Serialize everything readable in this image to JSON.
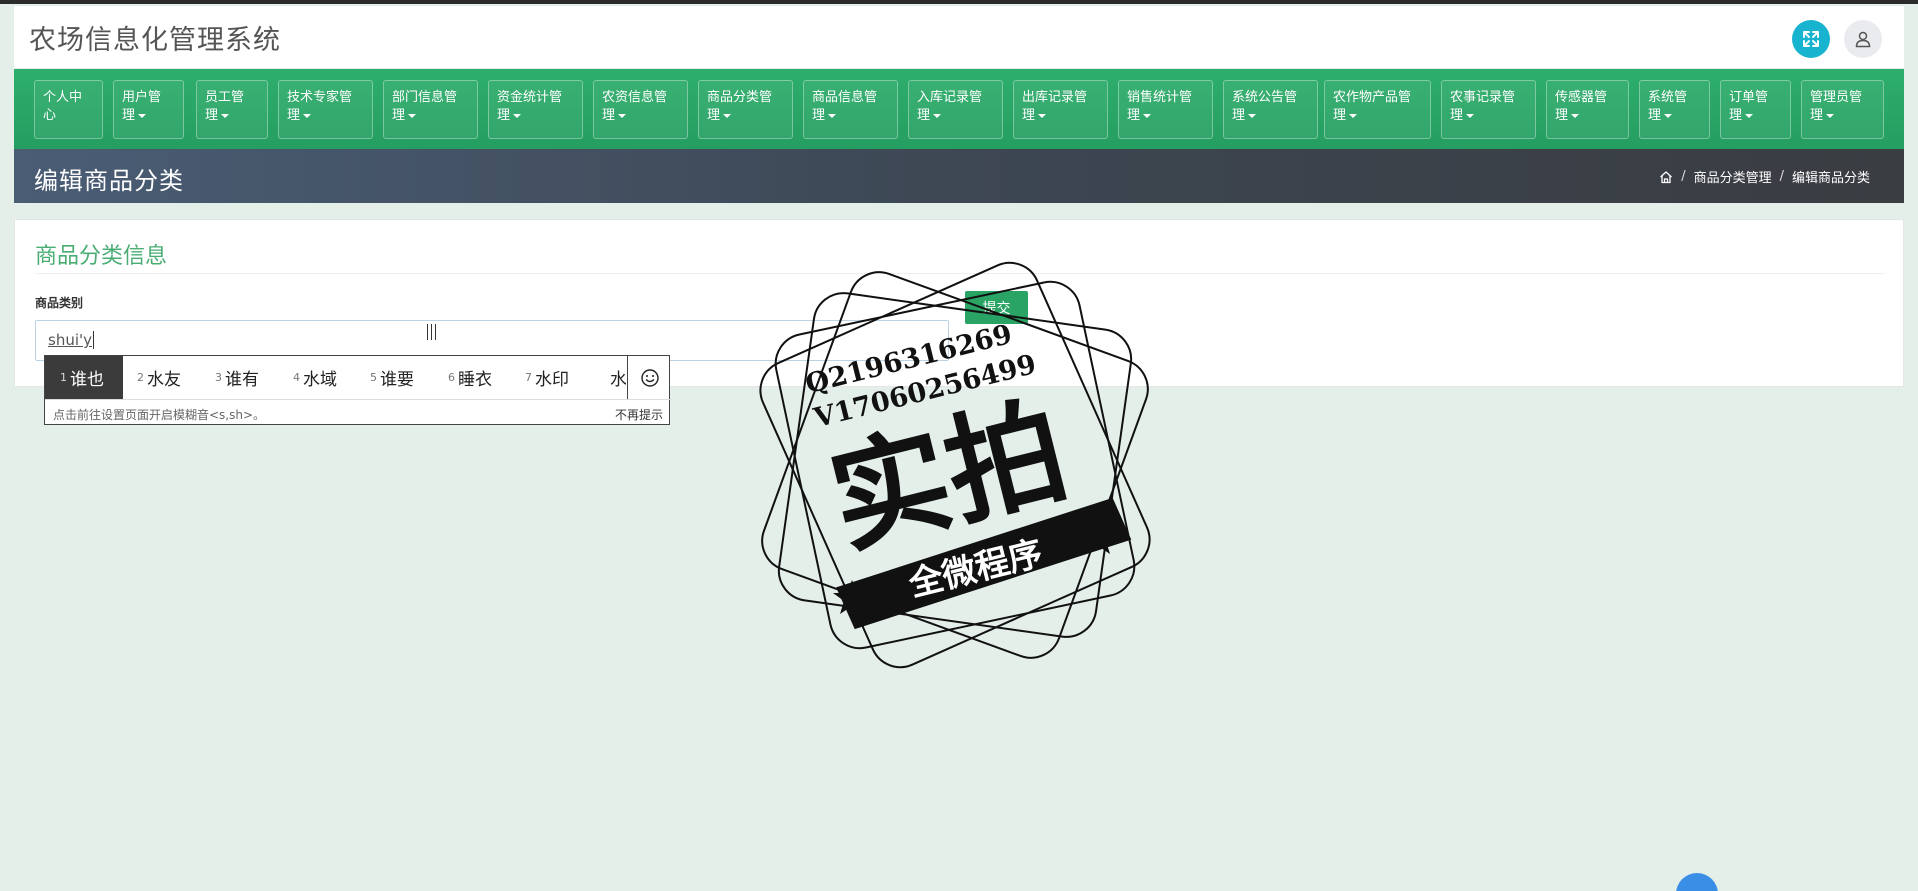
{
  "header": {
    "title": "农场信息化管理系统",
    "expand_icon": "expand-icon",
    "user_icon": "user-icon"
  },
  "nav": {
    "items": [
      {
        "line1": "个人中",
        "line2": "心",
        "caret": false
      },
      {
        "line1": "用户管",
        "line2": "理",
        "caret": true
      },
      {
        "line1": "员工管",
        "line2": "理",
        "caret": true
      },
      {
        "line1": "技术专家管",
        "line2": "理",
        "caret": true
      },
      {
        "line1": "部门信息管",
        "line2": "理",
        "caret": true
      },
      {
        "line1": "资金统计管",
        "line2": "理",
        "caret": true
      },
      {
        "line1": "农资信息管",
        "line2": "理",
        "caret": true
      },
      {
        "line1": "商品分类管",
        "line2": "理",
        "caret": true
      },
      {
        "line1": "商品信息管",
        "line2": "理",
        "caret": true
      },
      {
        "line1": "入库记录管",
        "line2": "理",
        "caret": true
      },
      {
        "line1": "出库记录管",
        "line2": "理",
        "caret": true
      },
      {
        "line1": "销售统计管",
        "line2": "理",
        "caret": true
      },
      {
        "line1": "系统公告管",
        "line2": "理",
        "caret": true
      },
      {
        "line1": "农作物产品管",
        "line2": "理",
        "caret": true
      },
      {
        "line1": "农事记录管",
        "line2": "理",
        "caret": true
      },
      {
        "line1": "传感器管",
        "line2": "理",
        "caret": true
      },
      {
        "line1": "系统管",
        "line2": "理",
        "caret": true
      },
      {
        "line1": "订单管",
        "line2": "理",
        "caret": true
      },
      {
        "line1": "管理员管",
        "line2": "理",
        "caret": true
      }
    ]
  },
  "page": {
    "title": "编辑商品分类",
    "breadcrumb": {
      "home_icon": "home-icon",
      "level1": "商品分类管理",
      "level2": "编辑商品分类",
      "separator": "/"
    }
  },
  "form": {
    "card_title": "商品分类信息",
    "field_label": "商品类别",
    "field_value": "shui'y",
    "submit_label": "提交"
  },
  "ime": {
    "candidates": [
      {
        "num": "1",
        "text": "谁也"
      },
      {
        "num": "2",
        "text": "水友"
      },
      {
        "num": "3",
        "text": "谁有"
      },
      {
        "num": "4",
        "text": "水域"
      },
      {
        "num": "5",
        "text": "谁要"
      },
      {
        "num": "6",
        "text": "睡衣"
      },
      {
        "num": "7",
        "text": "水印"
      },
      {
        "num": "",
        "text": "水"
      }
    ],
    "hint": "点击前往设置页面开启模糊音<s,sh>。",
    "dismiss": "不再提示",
    "emoji_icon": "smiley-icon"
  },
  "watermark": {
    "line1": "Q2196316269",
    "line2": "V17060256499",
    "main": "实拍",
    "ribbon": "全微程序"
  }
}
